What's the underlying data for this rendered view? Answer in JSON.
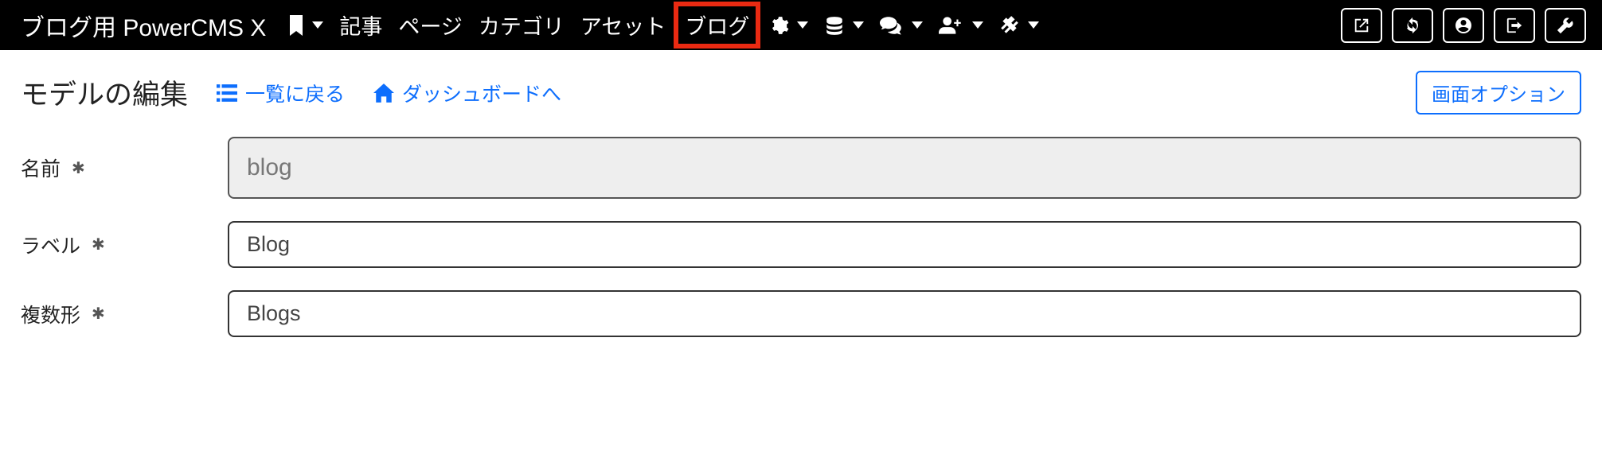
{
  "brand": "ブログ用 PowerCMS X",
  "nav": {
    "items": [
      {
        "label": "記事"
      },
      {
        "label": "ページ"
      },
      {
        "label": "カテゴリ"
      },
      {
        "label": "アセット"
      },
      {
        "label": "ブログ",
        "highlighted": true
      }
    ]
  },
  "page": {
    "title": "モデルの編集",
    "back_link": "一覧に戻る",
    "dashboard_link": "ダッシュボードへ",
    "options_button": "画面オプション"
  },
  "form": {
    "name": {
      "label": "名前",
      "value": "blog"
    },
    "label": {
      "label": "ラベル",
      "value": "Blog"
    },
    "plural": {
      "label": "複数形",
      "value": "Blogs"
    },
    "required_mark": "✱"
  }
}
